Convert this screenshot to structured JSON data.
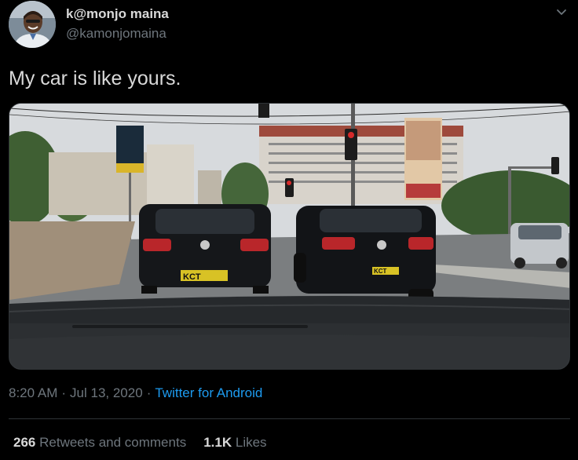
{
  "author": {
    "display_name": "k@monjo maina",
    "handle": "@kamonjomaina"
  },
  "tweet": {
    "text": "My car is like yours.",
    "time": "8:20 AM",
    "date": "Jul 13, 2020",
    "separator": "·",
    "source": "Twitter for Android"
  },
  "photo": {
    "plate_left": "KCT",
    "plate_right": "KCT"
  },
  "stats": {
    "retweets_count": "266",
    "retweets_label": "Retweets and comments",
    "likes_count": "1.1K",
    "likes_label": "Likes"
  },
  "icons": {
    "menu": "chevron-down-icon"
  },
  "colors": {
    "background": "#000000",
    "primary_text": "#d9d9d9",
    "secondary_text": "#6e767d",
    "link": "#1d9bf0",
    "divider": "#2f3336"
  }
}
